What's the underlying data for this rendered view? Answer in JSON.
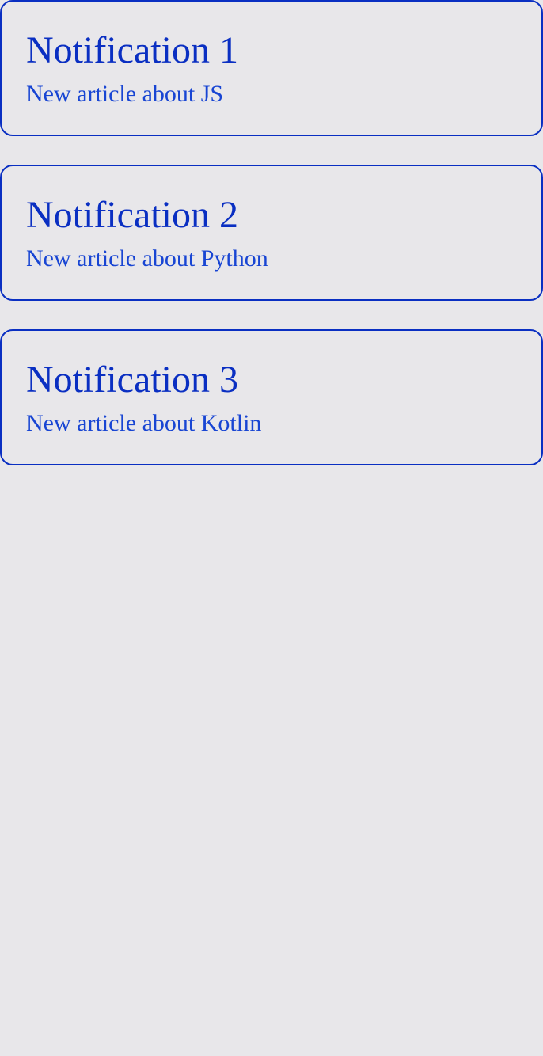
{
  "notifications": [
    {
      "title": "Notification 1",
      "text": "New article about JS"
    },
    {
      "title": "Notification 2",
      "text": "New article about Python"
    },
    {
      "title": "Notification 3",
      "text": "New article about Kotlin"
    }
  ],
  "colors": {
    "background": "#E8E7EA",
    "accent": "#0A2FC2",
    "body_text": "#1845D3"
  }
}
